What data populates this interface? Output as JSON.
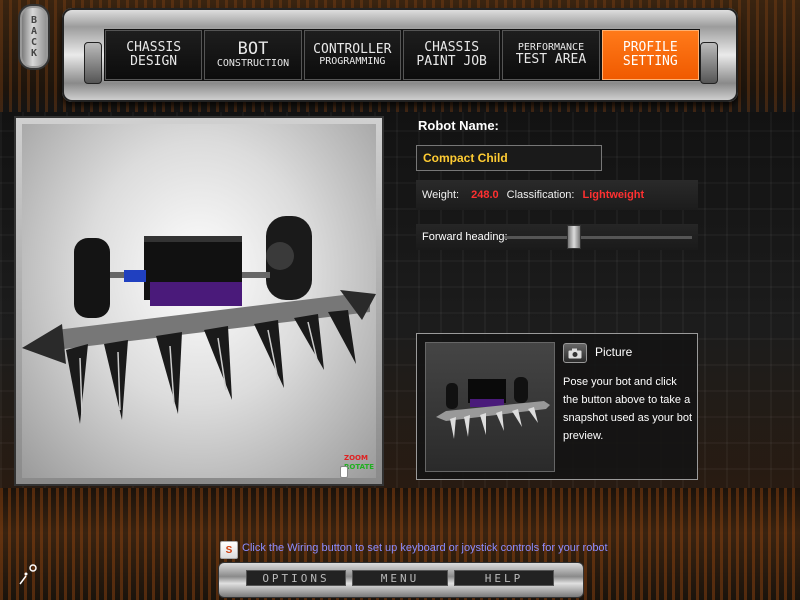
{
  "back_label": "BACK",
  "nav_tabs": [
    {
      "line1": "CHASSIS",
      "line2": "DESIGN",
      "active": false
    },
    {
      "line1": "BOT",
      "line2": "CONSTRUCTION",
      "active": false
    },
    {
      "line1": "CONTROLLER",
      "line2": "PROGRAMMING",
      "active": false
    },
    {
      "line1": "CHASSIS",
      "line2": "PAINT JOB",
      "active": false
    },
    {
      "line1": "PERFORMANCE",
      "line2": "TEST AREA",
      "active": false
    },
    {
      "line1": "PROFILE",
      "line2": "SETTING",
      "active": true
    }
  ],
  "viewport": {
    "zoom_label": "ZOOM",
    "rotate_label": "ROTATE"
  },
  "profile": {
    "robot_name_label": "Robot Name:",
    "robot_name_value": "Compact Child",
    "weight_label": "Weight:",
    "weight_value": "248.0",
    "classification_label": "Classification:",
    "classification_value": "Lightweight",
    "heading_label": "Forward heading:",
    "heading_level": 0.37
  },
  "preview": {
    "picture_label": "Picture",
    "description": "Pose your bot and click the button above to take a snapshot used as your bot preview."
  },
  "hint": {
    "text": "Click the Wiring button to set up keyboard or joystick controls for your robot"
  },
  "bottom_buttons": {
    "options": "OPTIONS",
    "menu": "MENU",
    "help": "HELP"
  },
  "colors": {
    "active_tab": "#f05a00",
    "robot_name": "#ffcc33",
    "stat_value": "#ff3030",
    "hint_text": "#8c8cff"
  }
}
